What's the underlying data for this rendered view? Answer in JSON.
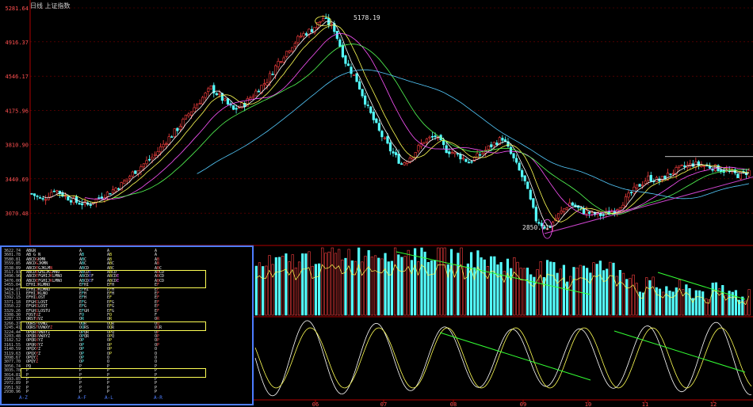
{
  "title": "日线 上证指数",
  "y_ticks": [
    "5281.64",
    "4916.37",
    "4546.17",
    "4175.96",
    "3810.90",
    "3440.69",
    "3070.48"
  ],
  "x_ticks": [
    "06",
    "07",
    "08",
    "09",
    "10",
    "11",
    "12"
  ],
  "annotations": {
    "high": "5178.19",
    "low": "2850.71"
  },
  "colors": {
    "up": "#ff4040",
    "down": "#55ffff",
    "grid": "#7a0000",
    "axis": "#b00000",
    "ma5": "#ffffff",
    "ma10": "#ffff55",
    "ma20": "#ff55ff",
    "ma30": "#55ff55",
    "ma60": "#55ccff",
    "trend": "#33ff33",
    "panel_border": "#4d7dff"
  },
  "chart_data": {
    "type": "candlestick",
    "ylim": [
      2850,
      5281.64
    ],
    "y_ticks": [
      5281.64,
      4916.37,
      4546.17,
      4175.96,
      3810.9,
      3440.69,
      3070.48
    ],
    "x_ticks": [
      "06",
      "07",
      "08",
      "09",
      "10",
      "11",
      "12"
    ],
    "annotations": [
      {
        "label": "5178.19",
        "value": 5178.19
      },
      {
        "label": "2850.71",
        "value": 2850.71
      }
    ],
    "close_path": [
      [
        0,
        3280
      ],
      [
        4,
        3210
      ],
      [
        8,
        3330
      ],
      [
        12,
        3250
      ],
      [
        16,
        3190
      ],
      [
        20,
        3160
      ],
      [
        24,
        3240
      ],
      [
        28,
        3300
      ],
      [
        32,
        3380
      ],
      [
        36,
        3500
      ],
      [
        40,
        3600
      ],
      [
        44,
        3700
      ],
      [
        48,
        3850
      ],
      [
        52,
        3980
      ],
      [
        56,
        4140
      ],
      [
        60,
        4280
      ],
      [
        64,
        4420
      ],
      [
        68,
        4300
      ],
      [
        72,
        4180
      ],
      [
        76,
        4250
      ],
      [
        80,
        4380
      ],
      [
        84,
        4500
      ],
      [
        88,
        4700
      ],
      [
        92,
        4850
      ],
      [
        96,
        4980
      ],
      [
        100,
        5050
      ],
      [
        104,
        5170
      ],
      [
        108,
        5050
      ],
      [
        112,
        4700
      ],
      [
        116,
        4500
      ],
      [
        120,
        4200
      ],
      [
        124,
        3950
      ],
      [
        128,
        3750
      ],
      [
        132,
        3600
      ],
      [
        136,
        3700
      ],
      [
        140,
        3850
      ],
      [
        144,
        3900
      ],
      [
        148,
        3750
      ],
      [
        152,
        3700
      ],
      [
        156,
        3620
      ],
      [
        160,
        3700
      ],
      [
        164,
        3800
      ],
      [
        168,
        3880
      ],
      [
        172,
        3650
      ],
      [
        176,
        3400
      ],
      [
        180,
        3000
      ],
      [
        184,
        2900
      ],
      [
        188,
        3050
      ],
      [
        192,
        3180
      ],
      [
        196,
        3100
      ],
      [
        200,
        3060
      ],
      [
        204,
        3050
      ],
      [
        208,
        3100
      ],
      [
        212,
        3220
      ],
      [
        216,
        3350
      ],
      [
        220,
        3450
      ],
      [
        224,
        3420
      ],
      [
        228,
        3500
      ],
      [
        232,
        3560
      ],
      [
        236,
        3600
      ],
      [
        240,
        3580
      ],
      [
        244,
        3560
      ],
      [
        248,
        3520
      ],
      [
        252,
        3480
      ],
      [
        256,
        3520
      ]
    ],
    "market_profile": {
      "price_levels": [
        "3622.74",
        "3601.78",
        "3580.81",
        "3559.85",
        "3538.89",
        "3517.93",
        "3496.96",
        "3476.00",
        "3455.04",
        "3434.07",
        "3413.11",
        "3392.15",
        "3371.18",
        "3350.22",
        "3329.26",
        "3308.30",
        "3287.33",
        "3266.37",
        "3245.41",
        "3224.44",
        "3203.48",
        "3182.52",
        "3161.55",
        "3140.59",
        "3119.63",
        "3098.67",
        "3077.70",
        "3056.74",
        "3035.78",
        "3014.81",
        "2993.85",
        "2972.89",
        "2951.92",
        "2930.96"
      ],
      "profiles": [
        [
          "ABGN",
          "AB G N",
          "ABCDGKMN",
          "ABCDGJKMN",
          "ABCDEGJKLMN",
          "ABCDEGHIJKLMNO",
          "ABCDEFGHIJKLMNO",
          "ABCDEFGHIJKLMNO",
          "EFHIJKLMNO",
          "EFHIJKLMNO",
          "EFHIJKLNO",
          "EFHILOST",
          "EFGHILOST",
          "EFGHILOST",
          "EFGHILOSTU",
          "FOSTUZ",
          "ORSTUVZ",
          "OQRSTUVWZ",
          "OQRSTUVWXYZ",
          "OPQRUVWXYZ",
          "OPQRUVWXYZ",
          "OPQRXYZ",
          "OPQRXYZ",
          "OPQXYZ",
          "OPQXYZ",
          "OPQYZ",
          "OPQYZ",
          "PQ",
          "P",
          "P",
          "P",
          "P",
          "P",
          "P"
        ]
      ],
      "footer": [
        "A-Z",
        "A-F",
        "A-L",
        "A-R"
      ]
    }
  }
}
